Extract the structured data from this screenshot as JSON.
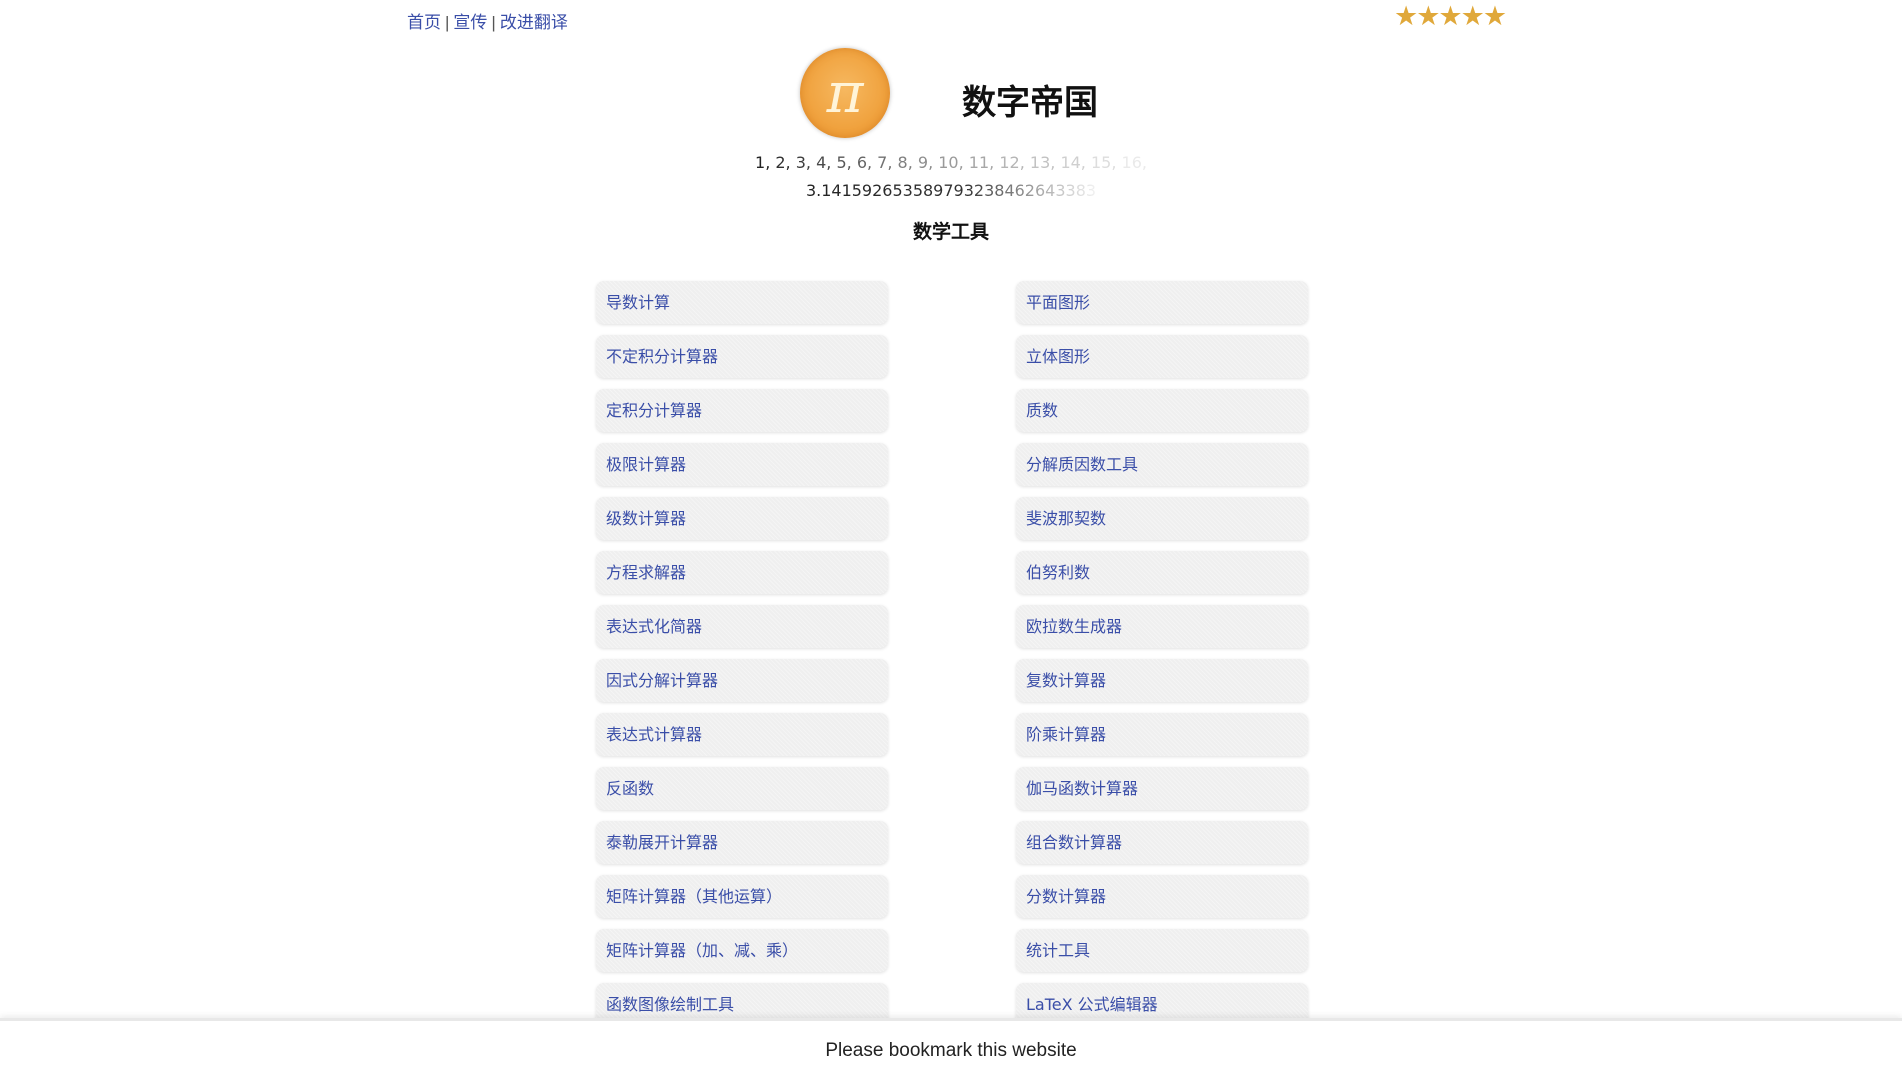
{
  "nav": {
    "home": "首页",
    "promote": "宣传",
    "translate": "改进翻译",
    "sep": "|"
  },
  "rating": {
    "stars": 5,
    "glyphs": "★★★★★"
  },
  "header": {
    "logo_symbol": "π",
    "title": "数字帝国"
  },
  "sequences": {
    "naturals": [
      "1,",
      "2,",
      "3,",
      "4,",
      "5,",
      "6,",
      "7,",
      "8,",
      "9,",
      "10,",
      "11,",
      "12,",
      "13,",
      "14,",
      "15,",
      "16,"
    ],
    "pi_digits": "3.141592653589793238462643383"
  },
  "tools_title": "数学工具",
  "tools_left": [
    "导数计算",
    "不定积分计算器",
    "定积分计算器",
    "极限计算器",
    "级数计算器",
    "方程求解器",
    "表达式化简器",
    "因式分解计算器",
    "表达式计算器",
    "反函数",
    "泰勒展开计算器",
    "矩阵计算器（其他运算）",
    "矩阵计算器（加、减、乘）",
    "函数图像绘制工具"
  ],
  "tools_right": [
    "平面图形",
    "立体图形",
    "质数",
    "分解质因数工具",
    "斐波那契数",
    "伯努利数",
    "欧拉数生成器",
    "复数计算器",
    "阶乘计算器",
    "伽马函数计算器",
    "组合数计算器",
    "分数计算器",
    "统计工具",
    "LaTeX 公式编辑器"
  ],
  "footer": {
    "text": "Please bookmark this website"
  },
  "colors": {
    "link": "#3a4ea8",
    "star": "#e0a83a",
    "logo": "#f0a23e"
  }
}
